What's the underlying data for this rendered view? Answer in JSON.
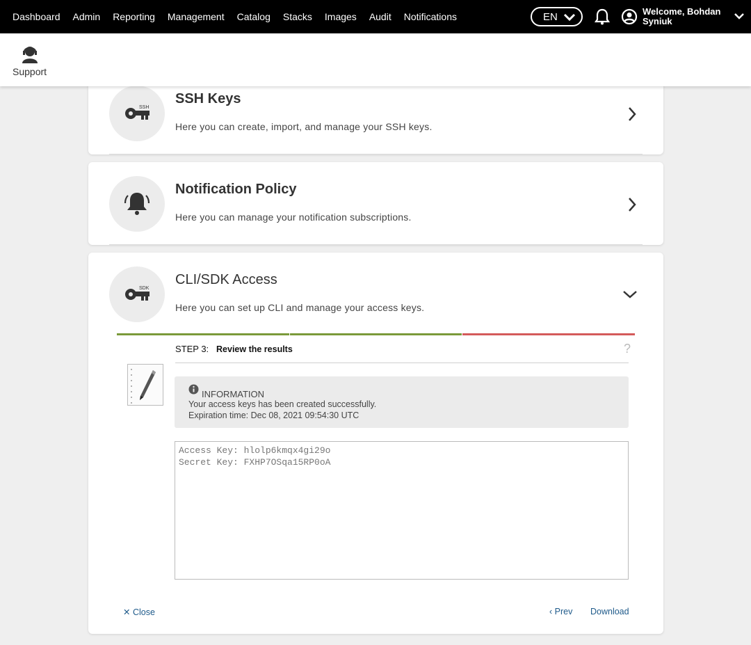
{
  "nav": {
    "items": [
      "Dashboard",
      "Admin",
      "Reporting",
      "Management",
      "Catalog",
      "Stacks",
      "Images",
      "Audit",
      "Notifications"
    ],
    "language": "EN",
    "welcome": "Welcome, Bohdan Syniuk"
  },
  "subheader": {
    "support_label": "Support"
  },
  "cards": {
    "ssh": {
      "title": "SSH Keys",
      "badge": "SSH",
      "description": "Here you can create, import, and manage your SSH keys."
    },
    "notification": {
      "title": "Notification Policy",
      "description": "Here you can manage your notification subscriptions."
    },
    "cli": {
      "title": "CLI/SDK Access",
      "badge": "SDK",
      "description": "Here you can set up CLI and manage your access keys."
    }
  },
  "wizard": {
    "step_number": "STEP 3:",
    "step_title": "Review the results",
    "help": "?",
    "progress_colors": [
      "#7a9a3a",
      "#7a9a3a",
      "#d45a5a"
    ],
    "info": {
      "title": "INFORMATION",
      "line1": "Your access keys has been created successfully.",
      "line2": "Expiration time: Dec 08, 2021 09:54:30 UTC"
    },
    "keys_text": "Access Key: hlolp6kmqx4gi29o\nSecret Key: FXHP7OSqa15RP0oA",
    "close_label": "Close",
    "prev_label": "Prev",
    "download_label": "Download"
  }
}
